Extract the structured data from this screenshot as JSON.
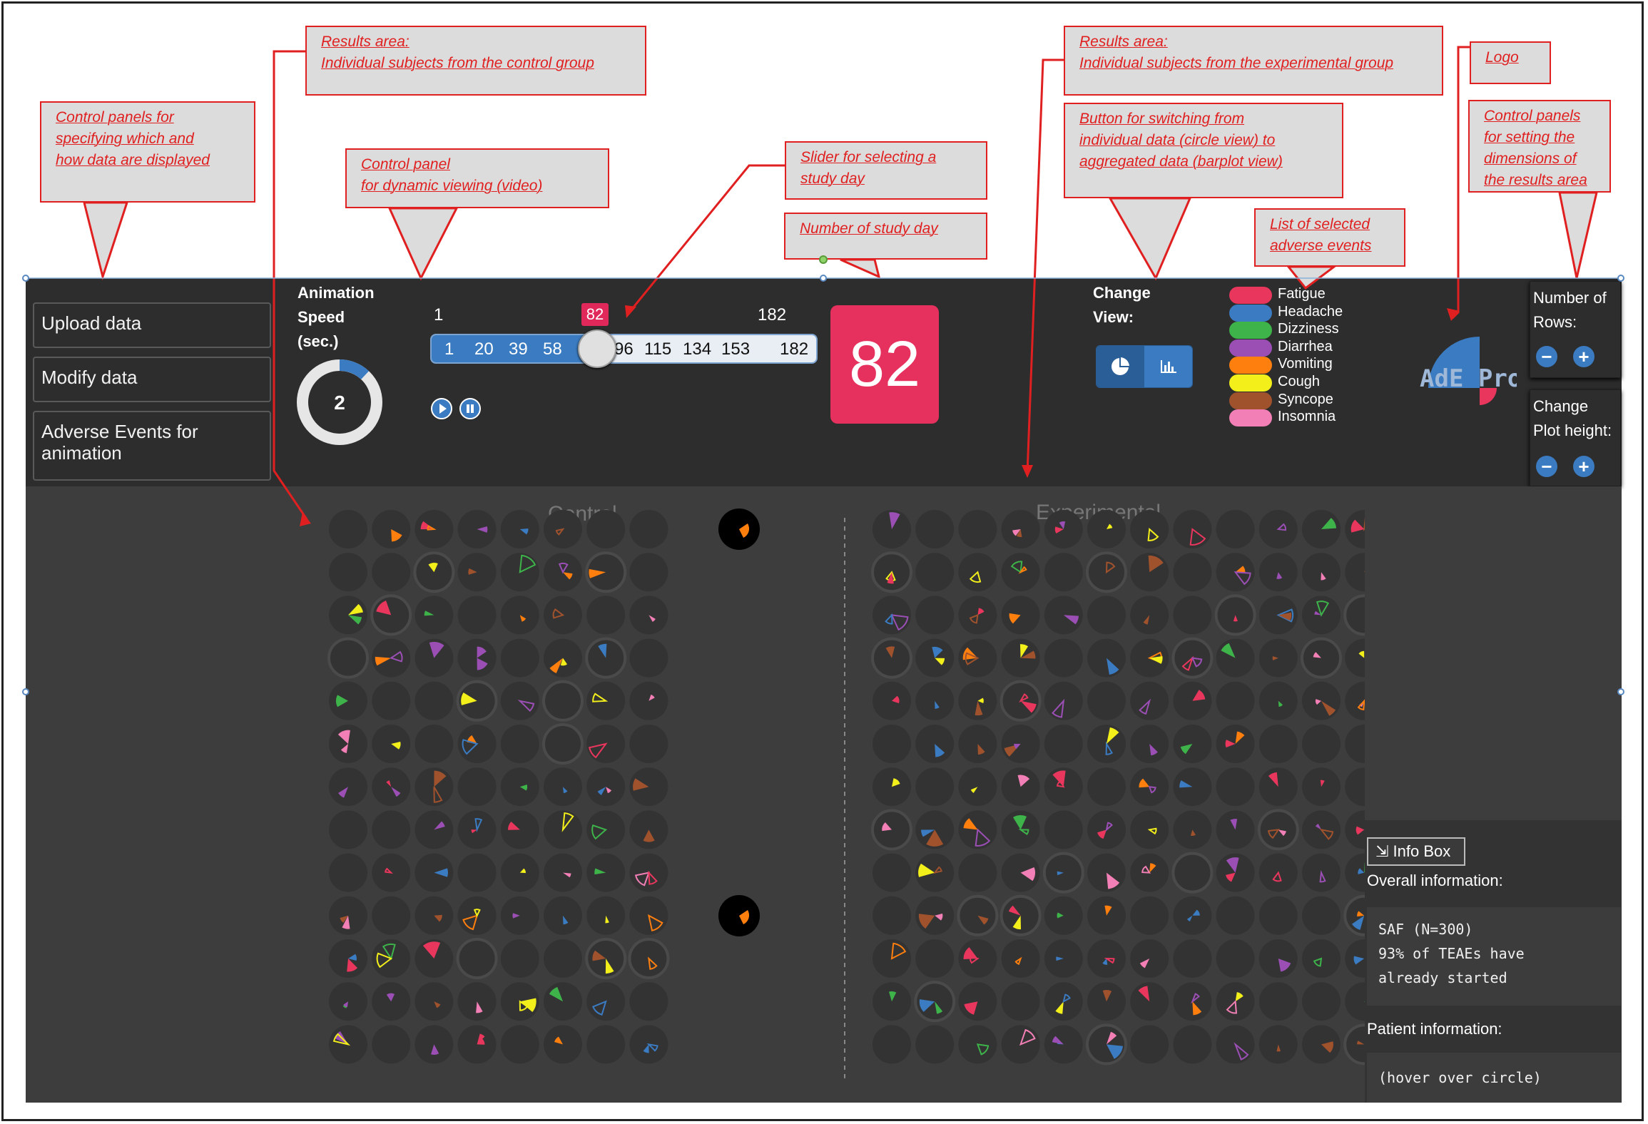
{
  "sidebar": {
    "buttons": [
      {
        "label": "Upload data"
      },
      {
        "label": "Modify data"
      },
      {
        "label": "Adverse Events for animation"
      }
    ]
  },
  "animation": {
    "label_line1": "Animation",
    "label_line2": "Speed",
    "label_line3": "(sec.)",
    "speed_value": "2",
    "speed_fraction": 0.12
  },
  "slider": {
    "min_label": "1",
    "max_label": "182",
    "current_day": "82",
    "ticks": [
      "1",
      "20",
      "39",
      "58",
      "96",
      "115",
      "134",
      "153",
      "182"
    ],
    "current_fraction": 0.45
  },
  "day_display": {
    "value": "82"
  },
  "change_view": {
    "label_line1": "Change",
    "label_line2": "View:",
    "active": "circle"
  },
  "legend": {
    "items": [
      {
        "label": "Fatigue",
        "color": "#e8365d"
      },
      {
        "label": "Headache",
        "color": "#3a7bc1"
      },
      {
        "label": "Dizziness",
        "color": "#3db34a"
      },
      {
        "label": "Diarrhea",
        "color": "#9b4fb5"
      },
      {
        "label": "Vomiting",
        "color": "#ff7f0e"
      },
      {
        "label": "Cough",
        "color": "#f2ef1a"
      },
      {
        "label": "Syncope",
        "color": "#a0522d"
      },
      {
        "label": "Insomnia",
        "color": "#f27fb5"
      }
    ]
  },
  "logo": {
    "text": "AdE Pro"
  },
  "rows_control": {
    "label_line1": "Number of",
    "label_line2": "Rows:"
  },
  "height_control": {
    "label_line1": "Change",
    "label_line2": "Plot height:"
  },
  "groups": {
    "control": "Control",
    "experimental": "Experimental"
  },
  "info_box": {
    "button_label": "Info Box",
    "overall_heading": "Overall information:",
    "overall_line1": "SAF (N=300)",
    "overall_line2": "93% of TEAEs have",
    "overall_line3": "already started",
    "patient_heading": "Patient information:",
    "patient_text": "(hover over circle)"
  },
  "callouts": {
    "results_control": [
      "Results area:",
      "Individual subjects from the control group"
    ],
    "results_experimental": [
      "Results area:",
      "Individual subjects from the experimental group"
    ],
    "logo": [
      "Logo"
    ],
    "control_panels_left": [
      "Control panels for",
      "specifying which and",
      "how data are displayed"
    ],
    "dynamic_viewing": [
      "Control panel",
      "for dynamic viewing (video)"
    ],
    "slider": [
      "Slider for selecting a",
      "study day"
    ],
    "number_of_day": [
      "Number of study day"
    ],
    "switch_button": [
      "Button for switching from",
      "individual data (circle view) to",
      "aggregated data (barplot view)"
    ],
    "ae_list": [
      "List of selected",
      "adverse events"
    ],
    "dimension_panels": [
      "Control panels",
      "for setting the",
      "dimensions of",
      "the results area"
    ]
  }
}
